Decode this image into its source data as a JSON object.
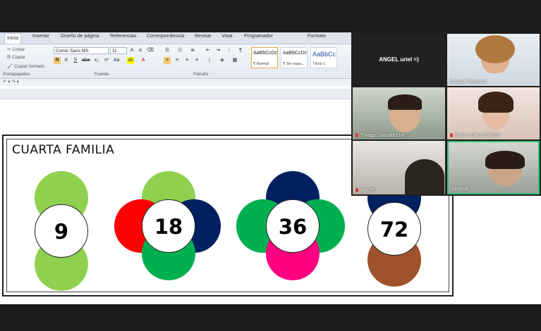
{
  "word": {
    "tabs": [
      "Inicio",
      "Insertar",
      "Diseño de página",
      "Referencias",
      "Correspondencia",
      "Revisar",
      "Vista",
      "Programador",
      "Formato"
    ],
    "clipboard": {
      "cut": "Cortar",
      "copy": "Copiar",
      "format_painter": "Copiar formato",
      "group": "Portapapeles"
    },
    "font": {
      "name": "Comic Sans MS",
      "size": "11",
      "group": "Fuente"
    },
    "paragraph": {
      "group": "Párrafo"
    },
    "styles": [
      {
        "sample": "AaBbCcDc",
        "name": "¶ Normal"
      },
      {
        "sample": "AaBbCcDc",
        "name": "¶ Sin espa..."
      },
      {
        "sample": "AaBbCc",
        "name": "Título 1"
      }
    ]
  },
  "document": {
    "heading": "CUARTA FAMILIA",
    "flowers": [
      {
        "number": "9"
      },
      {
        "number": "18"
      },
      {
        "number": "36"
      },
      {
        "number": "72"
      }
    ]
  },
  "meeting": {
    "tiles": [
      {
        "name": "ANGEL uriel =)"
      },
      {
        "name": "Daiana Reynoso"
      },
      {
        "name": "Thiago Gonzalez Ho..."
      },
      {
        "name": "Emma Giles Sañudo"
      },
      {
        "name": "BAUTI"
      },
      {
        "name": "Simona"
      }
    ]
  },
  "colors": {
    "light_green": "#8fd14f",
    "green": "#00b050",
    "red": "#ff0000",
    "navy": "#002060",
    "pink": "#ff0080",
    "brown": "#a0522d"
  }
}
